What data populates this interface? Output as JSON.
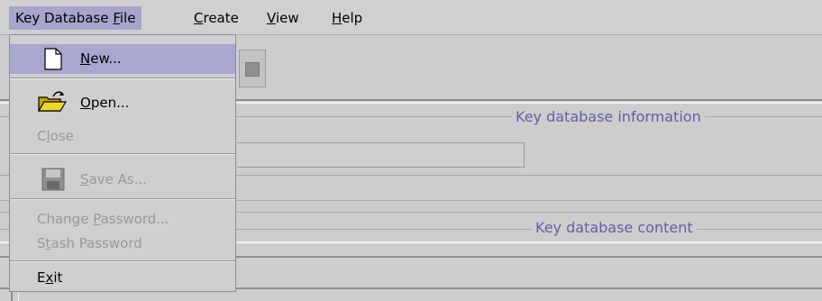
{
  "menubar": {
    "items": [
      {
        "pre": "Key Database ",
        "mn": "F",
        "post": "ile"
      },
      {
        "pre": "",
        "mn": "C",
        "post": "reate"
      },
      {
        "pre": "",
        "mn": "V",
        "post": "iew"
      },
      {
        "pre": "",
        "mn": "H",
        "post": "elp"
      }
    ]
  },
  "file_menu": {
    "new": {
      "pre": "",
      "mn": "N",
      "post": "ew..."
    },
    "open": {
      "pre": "",
      "mn": "O",
      "post": "pen..."
    },
    "close": {
      "pre": "C",
      "mn": "l",
      "post": "ose"
    },
    "saveas": {
      "pre": "",
      "mn": "S",
      "post": "ave As..."
    },
    "changepw": {
      "pre": "Change ",
      "mn": "P",
      "post": "assword..."
    },
    "stashpw": {
      "pre": "S",
      "mn": "t",
      "post": "ash Password"
    },
    "exit": {
      "pre": "E",
      "mn": "x",
      "post": "it"
    }
  },
  "main": {
    "info_title": "Key database information",
    "content_title": "Key database content"
  }
}
